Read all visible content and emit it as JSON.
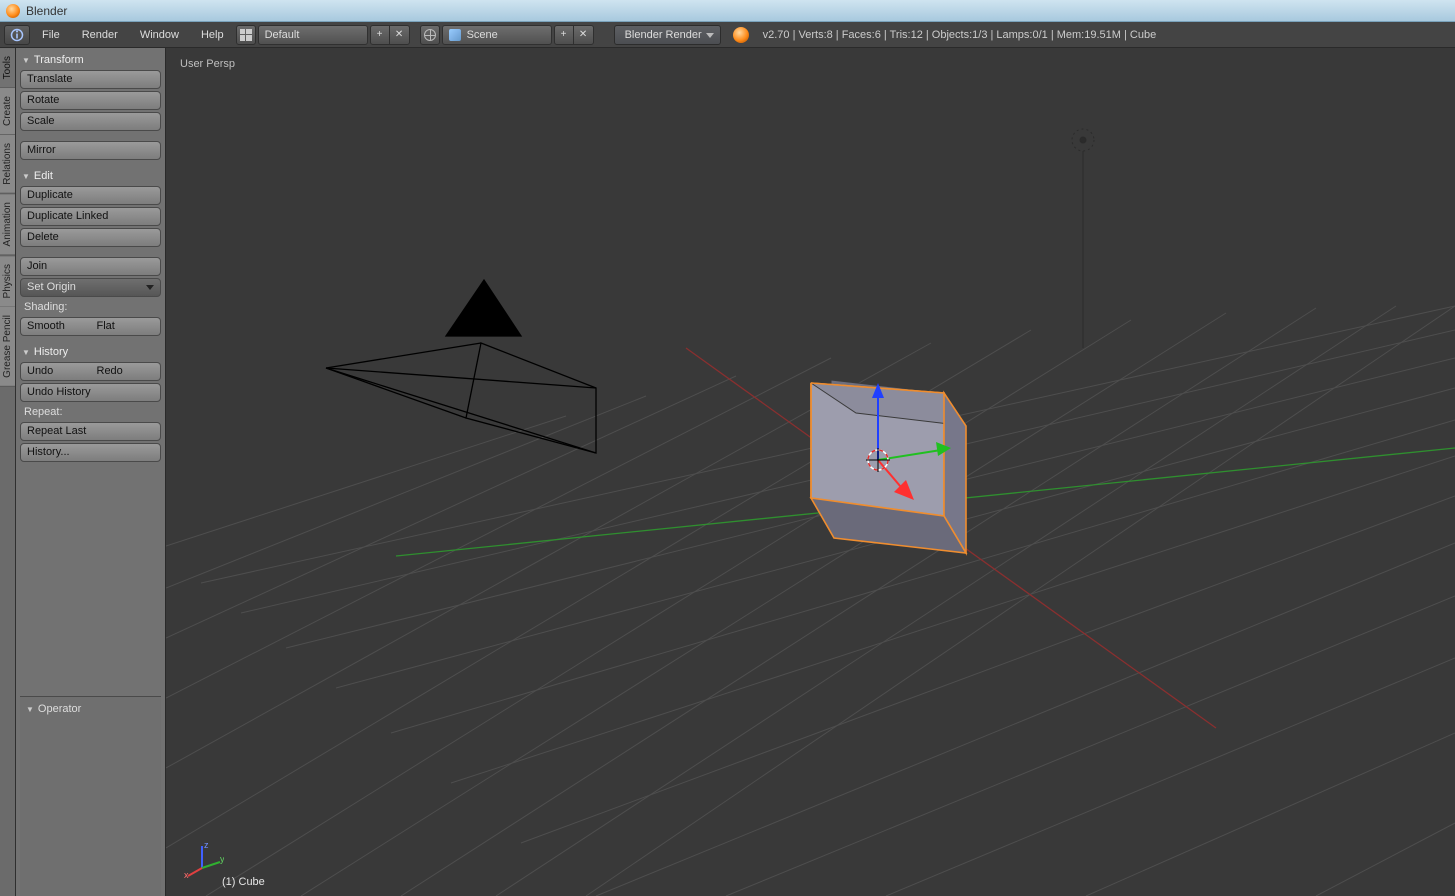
{
  "window": {
    "title": "Blender"
  },
  "menubar": {
    "items": [
      "File",
      "Render",
      "Window",
      "Help"
    ],
    "layout_label": "Default",
    "scene_label": "Scene",
    "engine": "Blender Render",
    "stats": "v2.70 | Verts:8 | Faces:6 | Tris:12 | Objects:1/3 | Lamps:0/1 | Mem:19.51M | Cube"
  },
  "toolshelf": {
    "tabs": [
      "Tools",
      "Create",
      "Relations",
      "Animation",
      "Physics",
      "Grease Pencil"
    ],
    "transform": {
      "title": "Transform",
      "translate": "Translate",
      "rotate": "Rotate",
      "scale": "Scale",
      "mirror": "Mirror"
    },
    "edit": {
      "title": "Edit",
      "duplicate": "Duplicate",
      "duplicate_linked": "Duplicate Linked",
      "delete": "Delete",
      "join": "Join",
      "set_origin": "Set Origin",
      "shading_label": "Shading:",
      "smooth": "Smooth",
      "flat": "Flat"
    },
    "history": {
      "title": "History",
      "undo": "Undo",
      "redo": "Redo",
      "undo_history": "Undo History",
      "repeat_label": "Repeat:",
      "repeat_last": "Repeat Last",
      "history_btn": "History..."
    },
    "operator_title": "Operator"
  },
  "viewport": {
    "overlay": "User Persp",
    "object_label": "(1) Cube"
  }
}
